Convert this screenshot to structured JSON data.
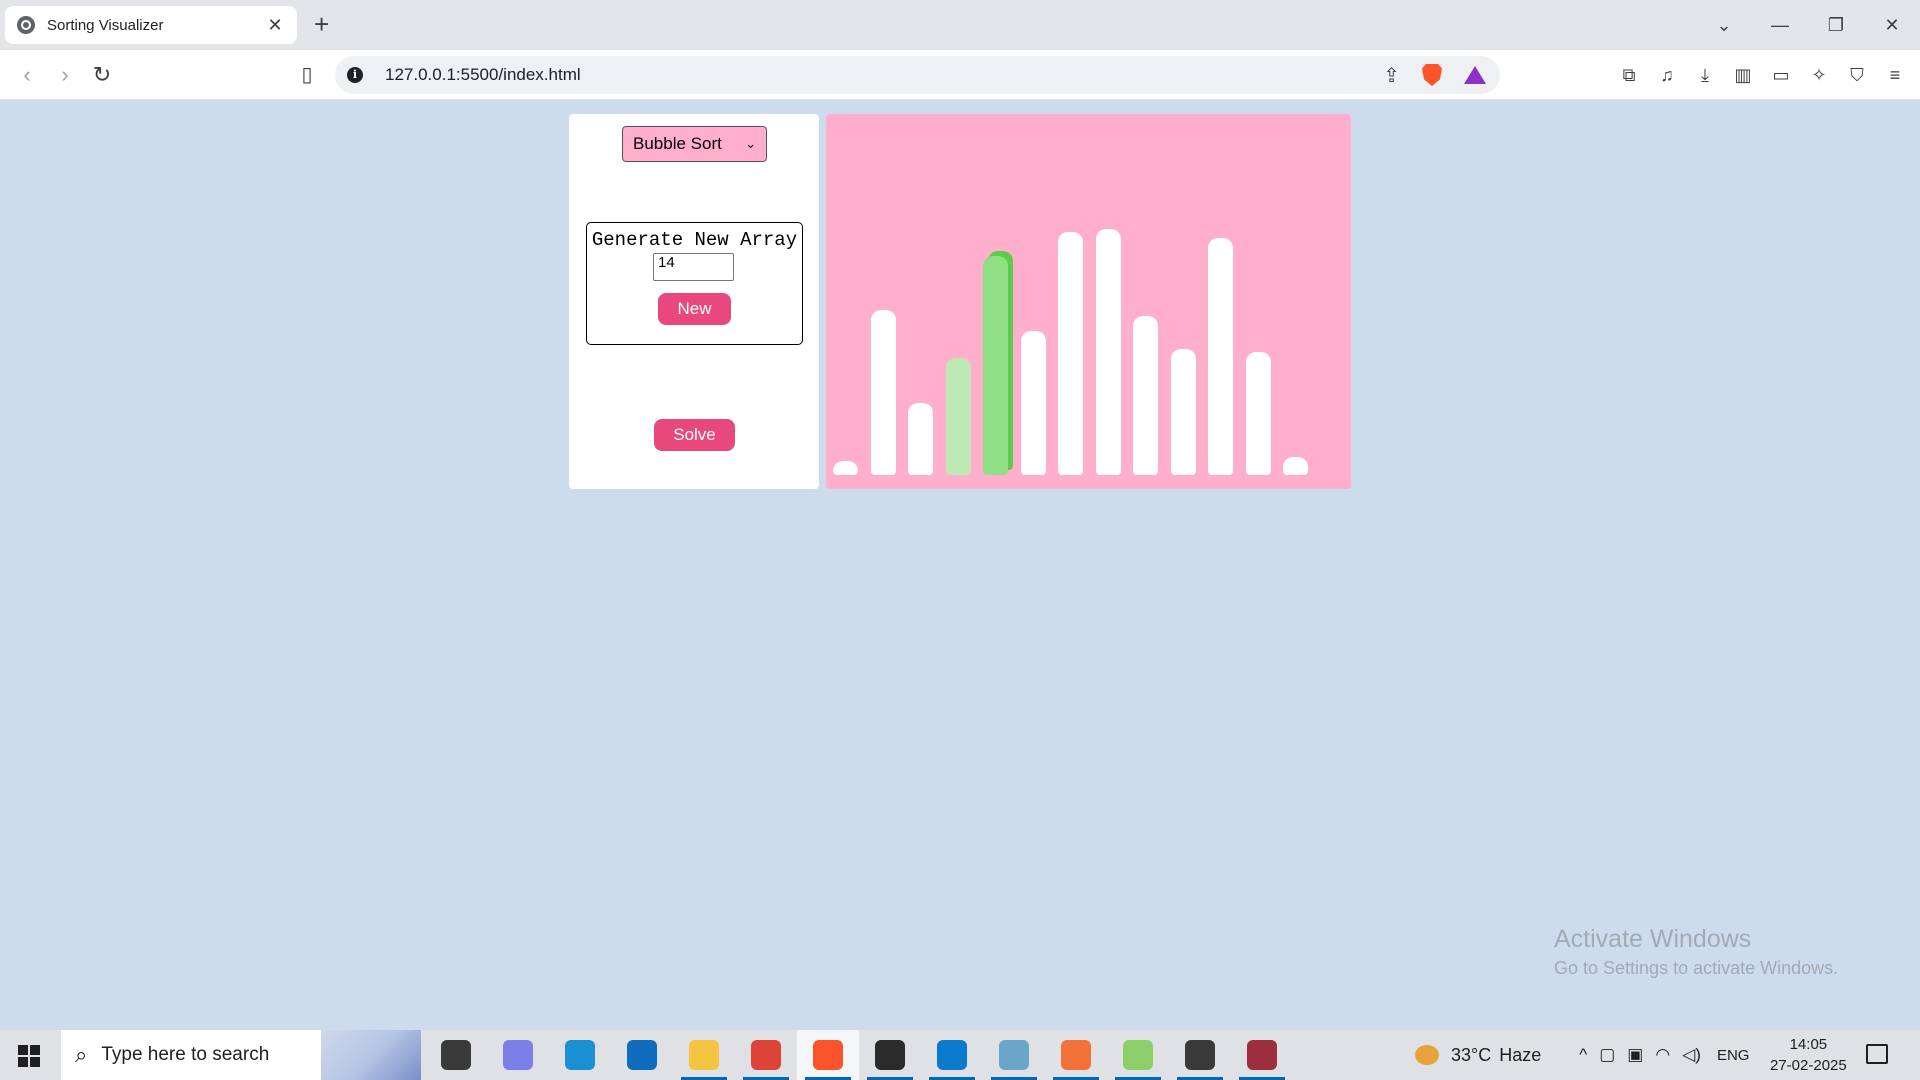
{
  "browser": {
    "tab_title": "Sorting Visualizer",
    "tab_close": "✕",
    "new_tab": "+",
    "url": "127.0.0.1:5500/index.html",
    "window_controls": {
      "tab_search": "⌄",
      "minimize": "—",
      "restore": "❐",
      "close": "✕"
    }
  },
  "page": {
    "algorithm_selected": "Bubble Sort",
    "generate_title": "Generate New Array",
    "array_size_value": "14",
    "new_button": "New",
    "solve_button": "Solve",
    "colors": {
      "accent": "#e9487d",
      "panel_pink": "#ffafcc",
      "page_bg": "#cddcec",
      "compare_light": "#bfe9b4",
      "compare_active": "#8fdf85"
    },
    "bars": [
      {
        "value": 4,
        "state": "default"
      },
      {
        "value": 55,
        "state": "default"
      },
      {
        "value": 24,
        "state": "default"
      },
      {
        "value": 39,
        "state": "compared"
      },
      {
        "value": 73,
        "state": "active"
      },
      {
        "value": 48,
        "state": "default"
      },
      {
        "value": 81,
        "state": "default"
      },
      {
        "value": 82,
        "state": "default"
      },
      {
        "value": 53,
        "state": "default"
      },
      {
        "value": 42,
        "state": "default"
      },
      {
        "value": 79,
        "state": "default"
      },
      {
        "value": 41,
        "state": "default"
      },
      {
        "value": 6,
        "state": "default"
      }
    ]
  },
  "watermark": {
    "line1": "Activate Windows",
    "line2": "Go to Settings to activate Windows."
  },
  "taskbar": {
    "search_placeholder": "Type here to search",
    "temperature": "33°C",
    "weather": "Haze",
    "language": "ENG",
    "time": "14:05",
    "date": "27-02-2025",
    "apps": [
      {
        "name": "task-view-icon",
        "color": "#3a3a3a",
        "running": false
      },
      {
        "name": "copilot-icon",
        "color": "#7b7fe8",
        "running": false
      },
      {
        "name": "edge-icon",
        "color": "#1b8fd4",
        "running": false
      },
      {
        "name": "outlook-icon",
        "color": "#0f6cbd",
        "running": false
      },
      {
        "name": "file-explorer-icon",
        "color": "#f4c542",
        "running": true
      },
      {
        "name": "chrome-icon",
        "color": "#db4437",
        "running": true
      },
      {
        "name": "brave-icon",
        "color": "#fb542b",
        "running": true
      },
      {
        "name": "terminal-icon",
        "color": "#2b2b2b",
        "running": true
      },
      {
        "name": "vscode-icon",
        "color": "#0a7acc",
        "running": true
      },
      {
        "name": "pen-app-icon",
        "color": "#6aa6c9",
        "running": true
      },
      {
        "name": "sublime-icon",
        "color": "#f27138",
        "running": true
      },
      {
        "name": "git-app-icon",
        "color": "#8ccf6a",
        "running": true
      },
      {
        "name": "settings-icon",
        "color": "#3a3a3a",
        "running": true
      },
      {
        "name": "winrar-icon",
        "color": "#9b2f3d",
        "running": true
      }
    ]
  }
}
